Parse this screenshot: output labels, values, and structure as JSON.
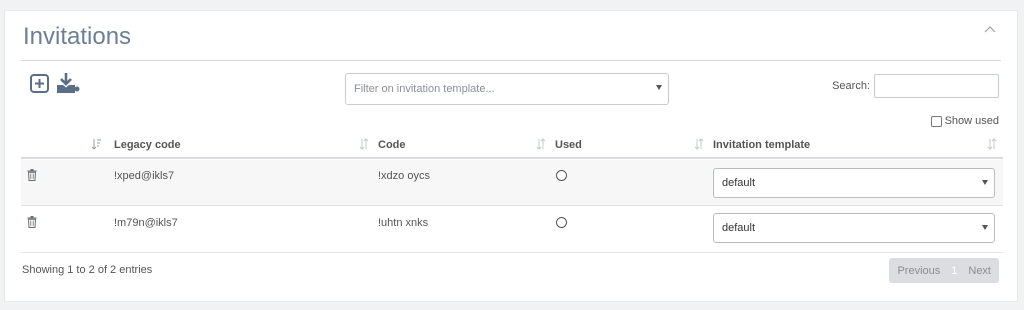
{
  "panel": {
    "title": "Invitations"
  },
  "toolbar": {
    "add_icon": "add-square-icon",
    "import_icon": "download-tray-icon",
    "filter_placeholder": "Filter on invitation template...",
    "search_label": "Search:",
    "search_value": "",
    "show_used_label": "Show used",
    "show_used_checked": false
  },
  "table": {
    "columns": [
      "Legacy code",
      "Code",
      "Used",
      "Invitation template"
    ],
    "rows": [
      {
        "legacy_code": "!xped@ikls7",
        "code": "!xdzo oycs",
        "used": false,
        "template": "default"
      },
      {
        "legacy_code": "!m79n@ikls7",
        "code": "!uhtn xnks",
        "used": false,
        "template": "default"
      }
    ]
  },
  "footer": {
    "info": "Showing 1 to 2 of 2 entries",
    "previous": "Previous",
    "current_page": "1",
    "next": "Next"
  },
  "colors": {
    "title": "#6d7f95",
    "text": "#555555",
    "stripe": "#f7f7f8",
    "pager_bg": "#dcdde0"
  }
}
